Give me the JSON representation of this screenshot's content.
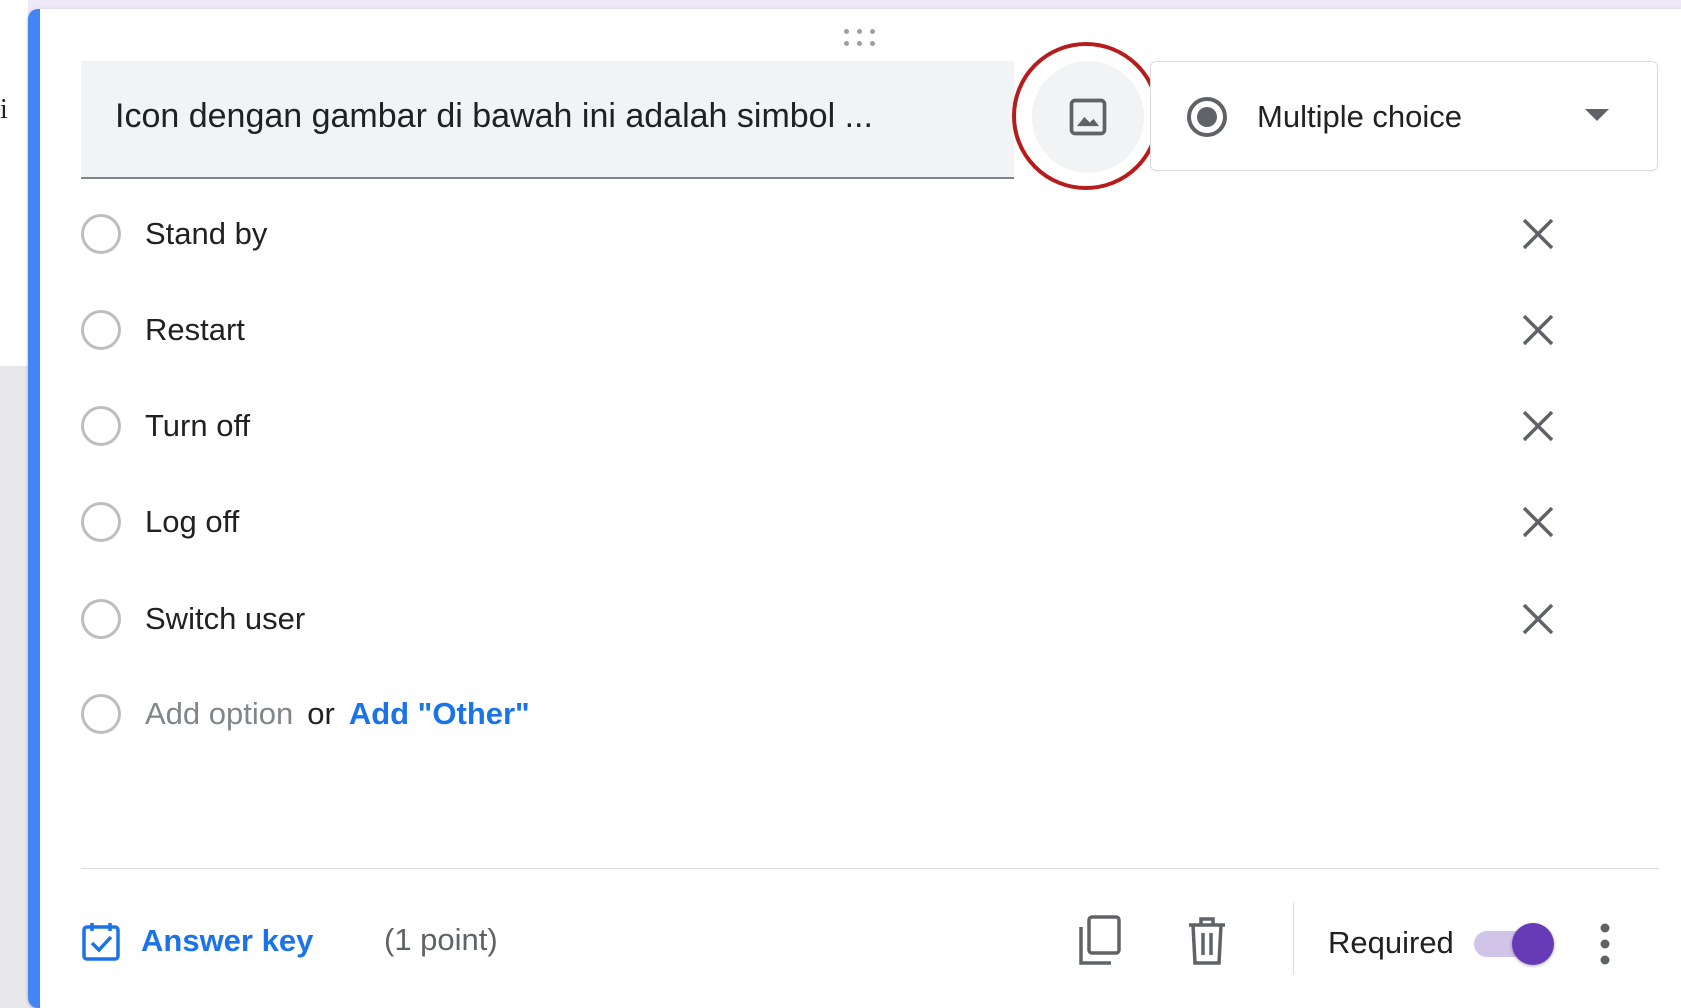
{
  "page_edge_char": "i",
  "question": {
    "title": "Icon dengan gambar di bawah ini adalah simbol ..."
  },
  "question_type": {
    "selected": "Multiple choice",
    "icon": "radio-button-checked-icon"
  },
  "options": [
    {
      "label": "Stand by"
    },
    {
      "label": "Restart"
    },
    {
      "label": "Turn off"
    },
    {
      "label": "Log off"
    },
    {
      "label": "Switch user"
    }
  ],
  "add_row": {
    "add_option": "Add option",
    "or": "or",
    "add_other": "Add \"Other\""
  },
  "footer": {
    "answer_key_label": "Answer key",
    "points": "(1 point)",
    "required_label": "Required",
    "required_on": true
  },
  "colors": {
    "accent": "#4285f4",
    "link": "#1a73e8",
    "toggle": "#673ab7",
    "highlight": "#b71c1c"
  },
  "icons": [
    "drag-handle-icon",
    "image-icon",
    "close-icon",
    "answer-key-checkbox-icon",
    "duplicate-icon",
    "trash-icon",
    "more-vert-icon"
  ]
}
